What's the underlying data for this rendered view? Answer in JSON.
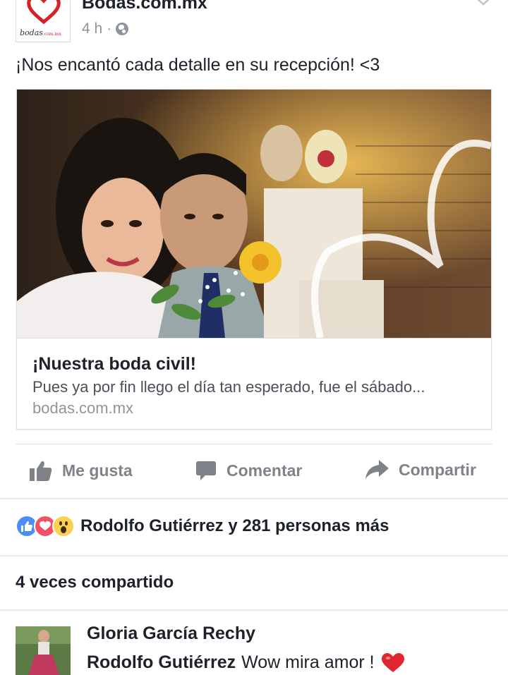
{
  "post": {
    "page_name": "Bodas.com.mx",
    "time": "4 h",
    "separator": "·",
    "privacy_icon": "globe-icon",
    "text": "¡Nos encantó cada detalle en su recepción! <3",
    "avatar_logo": "bodas.com.mx"
  },
  "link_card": {
    "title": "¡Nuestra boda civil!",
    "description": "Pues ya por fin llego el día tan esperado, fue el sábado...",
    "domain": "bodas.com.mx"
  },
  "actions": {
    "like": "Me gusta",
    "comment": "Comentar",
    "share": "Compartir"
  },
  "reactions": {
    "icons": [
      "like-icon",
      "love-icon",
      "wow-icon"
    ],
    "summary": "Rodolfo Gutiérrez y 281 personas más"
  },
  "shares": {
    "label": "4 veces compartido"
  },
  "comment": {
    "author": "Gloria García Rechy",
    "mentioned_name": "Rodolfo Gutiérrez",
    "text": "Wow mira amor !"
  },
  "colors": {
    "text": "#1d2129",
    "muted": "#90949c",
    "action": "#7f8389",
    "like_blue": "#4c8ef7",
    "love_red": "#f25268",
    "wow_yellow": "#fdd052",
    "brand_red": "#d2232a"
  }
}
